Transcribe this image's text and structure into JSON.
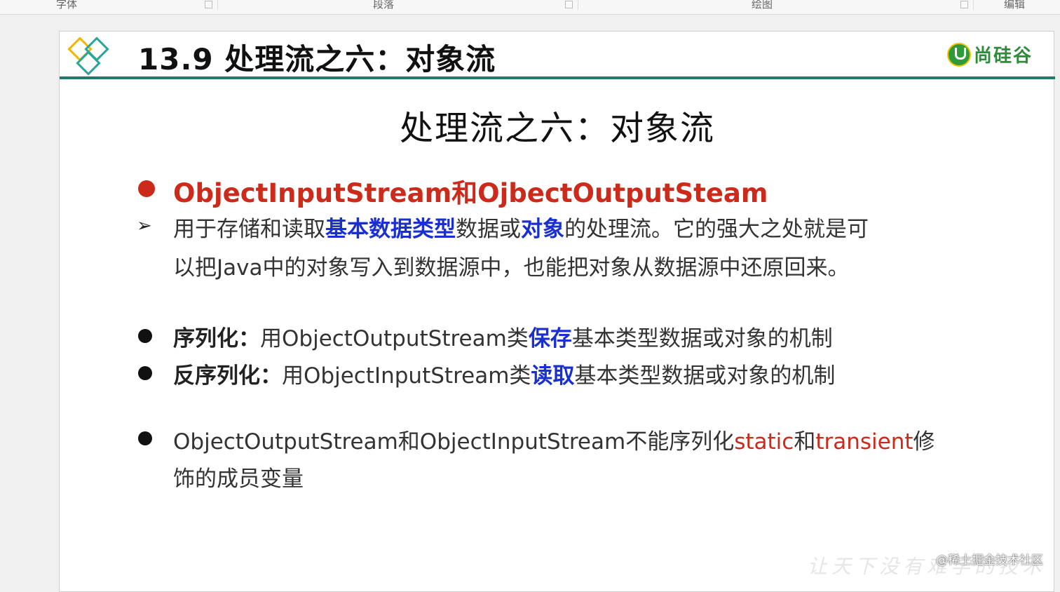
{
  "ribbon": {
    "groups": [
      "字体",
      "段落",
      "绘图",
      "编辑"
    ]
  },
  "header": {
    "title": "13.9 处理流之六：对象流",
    "brand": "尚硅谷",
    "accent_color": "#1f7a6d"
  },
  "slide": {
    "title": "处理流之六：对象流",
    "heading": "ObjectInputStream和OjbectOutputSteam",
    "para1": {
      "l1_a": "用于存储和读取",
      "l1_b": "基本数据类型",
      "l1_c": "数据或",
      "l1_d": "对象",
      "l1_e": "的处理流。它的强大之处就是可",
      "l2": "以把Java中的对象写入到数据源中，也能把对象从数据源中还原回来。"
    },
    "serialize": {
      "label": "序列化：",
      "a": "用ObjectOutputStream类",
      "b": "保存",
      "c": "基本类型数据或对象的机制"
    },
    "deserialize": {
      "label": "反序列化：",
      "a": "用ObjectInputStream类",
      "b": "读取",
      "c": "基本类型数据或对象的机制"
    },
    "note": {
      "a": "ObjectOutputStream和ObjectInputStream不能序列化",
      "b": "static",
      "c": "和",
      "d": "transient",
      "e": "修",
      "l2": "饰的成员变量"
    }
  },
  "watermark": "@稀土掘金技术社区",
  "faint_watermark": "让天下没有难学的技术",
  "colors": {
    "heading_red": "#cc2a1a",
    "emphasis_blue": "#1a2fd0",
    "brand_green": "#2f8a3a"
  }
}
